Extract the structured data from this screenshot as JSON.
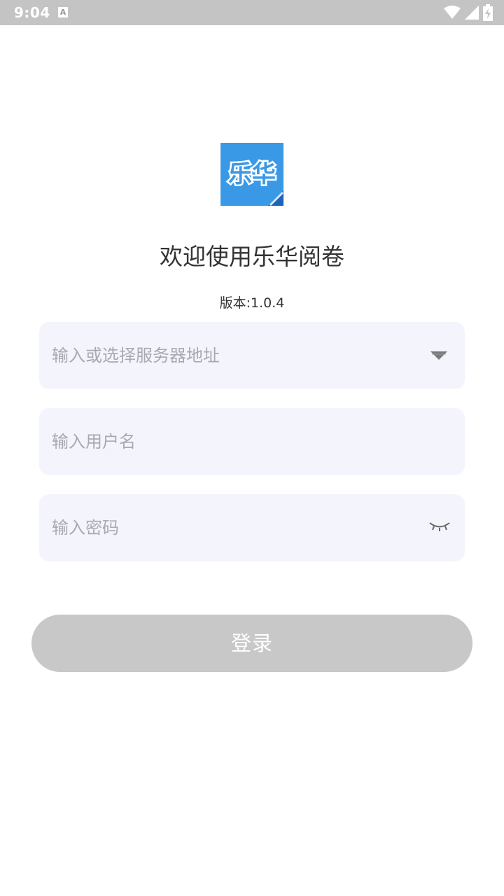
{
  "status_bar": {
    "time": "9:04",
    "notification_icon": "text-a-icon",
    "icons": [
      "wifi-icon",
      "signal-icon",
      "battery-charging-icon"
    ]
  },
  "logo": {
    "text": "乐华",
    "color": "#3a99e6"
  },
  "welcome": {
    "title": "欢迎使用乐华阅卷",
    "version": "版本:1.0.4"
  },
  "form": {
    "server": {
      "placeholder": "输入或选择服务器地址",
      "icon": "dropdown-triangle-icon"
    },
    "username": {
      "placeholder": "输入用户名"
    },
    "password": {
      "placeholder": "输入密码",
      "icon": "eye-closed-icon"
    }
  },
  "login_button": {
    "label": "登录",
    "color": "#c8c8c8"
  }
}
